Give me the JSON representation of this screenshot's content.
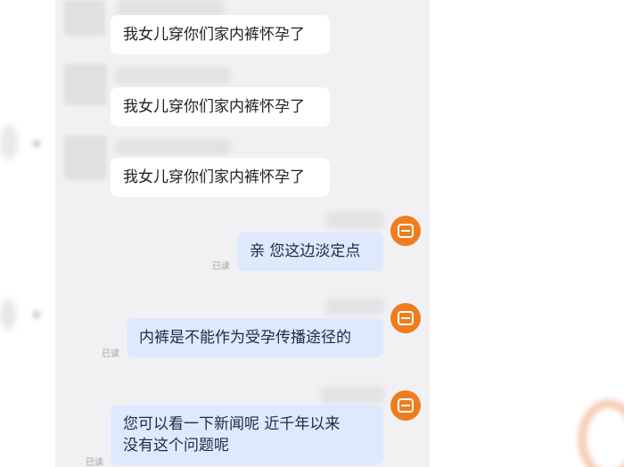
{
  "customer_messages": [
    {
      "text": "我女儿穿你们家内裤怀孕了"
    },
    {
      "text": "我女儿穿你们家内裤怀孕了"
    },
    {
      "text": "我女儿穿你们家内裤怀孕了"
    }
  ],
  "agent_messages": [
    {
      "lines": [
        "亲 您这边淡定点"
      ],
      "status": "已读"
    },
    {
      "lines": [
        "内裤是不能作为受孕传播途径的"
      ],
      "status": "已读"
    },
    {
      "lines": [
        "您可以看一下新闻呢 近千年以来",
        "没有这个问题呢"
      ],
      "status": "已读"
    }
  ],
  "colors": {
    "chat_background": "#f1f1f3",
    "incoming_bubble": "#ffffff",
    "outgoing_bubble": "#dfe9fd",
    "agent_avatar": "#ef7d1f"
  },
  "icons": {
    "agent_avatar": "orange-chat-avatar-icon"
  }
}
